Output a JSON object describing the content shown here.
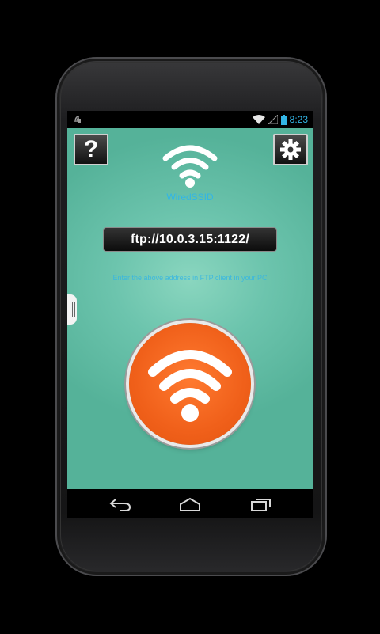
{
  "status_bar": {
    "time": "8:23",
    "icons": [
      "wifi-signal-icon",
      "cell-signal-icon",
      "battery-icon"
    ],
    "accent_color": "#33b5e5"
  },
  "app": {
    "help_label": "?",
    "ssid": "WiredSSID",
    "ftp_address": "ftp://10.0.3.15:1122/",
    "instruction": "Enter the above address in FTP client in your PC",
    "background_color": "#6cc4ad",
    "power_button_color": "#f0601a"
  },
  "nav": {
    "buttons": [
      "back-icon",
      "home-icon",
      "recent-apps-icon"
    ]
  }
}
